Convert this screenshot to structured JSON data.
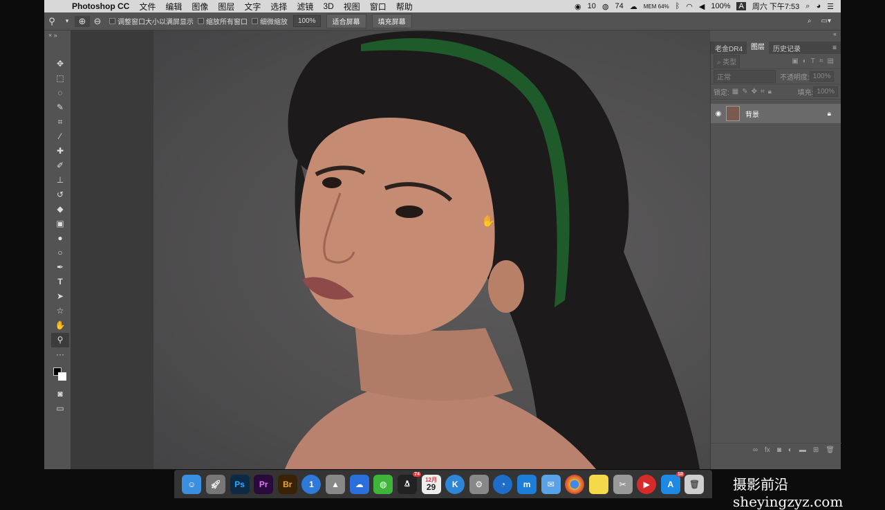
{
  "menubar": {
    "app_name": "Photoshop CC",
    "items": [
      "文件",
      "编辑",
      "图像",
      "图层",
      "文字",
      "选择",
      "滤镜",
      "3D",
      "视图",
      "窗口",
      "帮助"
    ],
    "tray": {
      "tray_num1": "10",
      "tray_num2": "74",
      "mem": "MEM 64%",
      "battery": "100%",
      "input": "A",
      "clock": "周六 下午7:53"
    }
  },
  "options": {
    "cb1": "调整窗口大小以满屏显示",
    "cb2": "缩放所有窗口",
    "cb3": "细微缩放",
    "zoom": "100%",
    "btn_fit": "适合屏幕",
    "btn_fill": "填充屏幕"
  },
  "right_panel": {
    "tabs": [
      "老金DR4",
      "图层",
      "历史记录"
    ],
    "filter_placeholder": "类型",
    "blend_mode": "正常",
    "opacity_label": "不透明度:",
    "opacity_value": "100%",
    "lock_label": "锁定:",
    "fill_label": "填充:",
    "fill_value": "100%",
    "layer_name": "背景"
  },
  "dock": {
    "apps": [
      {
        "name": "finder",
        "label": "",
        "color": "#3b8fe0"
      },
      {
        "name": "launchpad",
        "label": "",
        "color": "#777"
      },
      {
        "name": "photoshop",
        "label": "Ps",
        "color": "#0d2a44"
      },
      {
        "name": "premiere",
        "label": "Pr",
        "color": "#2a0a3d"
      },
      {
        "name": "bridge",
        "label": "Br",
        "color": "#3a2304"
      },
      {
        "name": "1password",
        "label": "1",
        "color": "#2f7ad8"
      },
      {
        "name": "affinity",
        "label": "",
        "color": "#888"
      },
      {
        "name": "baidu-netdisk",
        "label": "",
        "color": "#2b6fdc"
      },
      {
        "name": "wechat",
        "label": "",
        "color": "#3fb43a"
      },
      {
        "name": "qq",
        "label": "",
        "color": "#222"
      },
      {
        "name": "calendar",
        "label": "29",
        "color": "#eee"
      },
      {
        "name": "kuaiya",
        "label": "K",
        "color": "#2f86d6"
      },
      {
        "name": "system-prefs",
        "label": "",
        "color": "#888"
      },
      {
        "name": "edge",
        "label": "",
        "color": "#1d6dc9"
      },
      {
        "name": "maxthon",
        "label": "",
        "color": "#1c7ed6"
      },
      {
        "name": "mail",
        "label": "",
        "color": "#5aa2e8"
      },
      {
        "name": "chrome",
        "label": "",
        "color": "#e8ad2c"
      },
      {
        "name": "notes",
        "label": "",
        "color": "#f5d94a"
      },
      {
        "name": "utilities",
        "label": "",
        "color": "#999"
      },
      {
        "name": "infuse",
        "label": "",
        "color": "#d72b2b"
      },
      {
        "name": "app-store",
        "label": "",
        "color": "#1e88e5"
      },
      {
        "name": "trash",
        "label": "",
        "color": "#cfcfcf"
      }
    ]
  },
  "badges": {
    "wechat_badge": "74",
    "calendar_month": "12月",
    "appstore_badge": "10"
  },
  "watermark": "摄影前沿sheyingzyz.com"
}
